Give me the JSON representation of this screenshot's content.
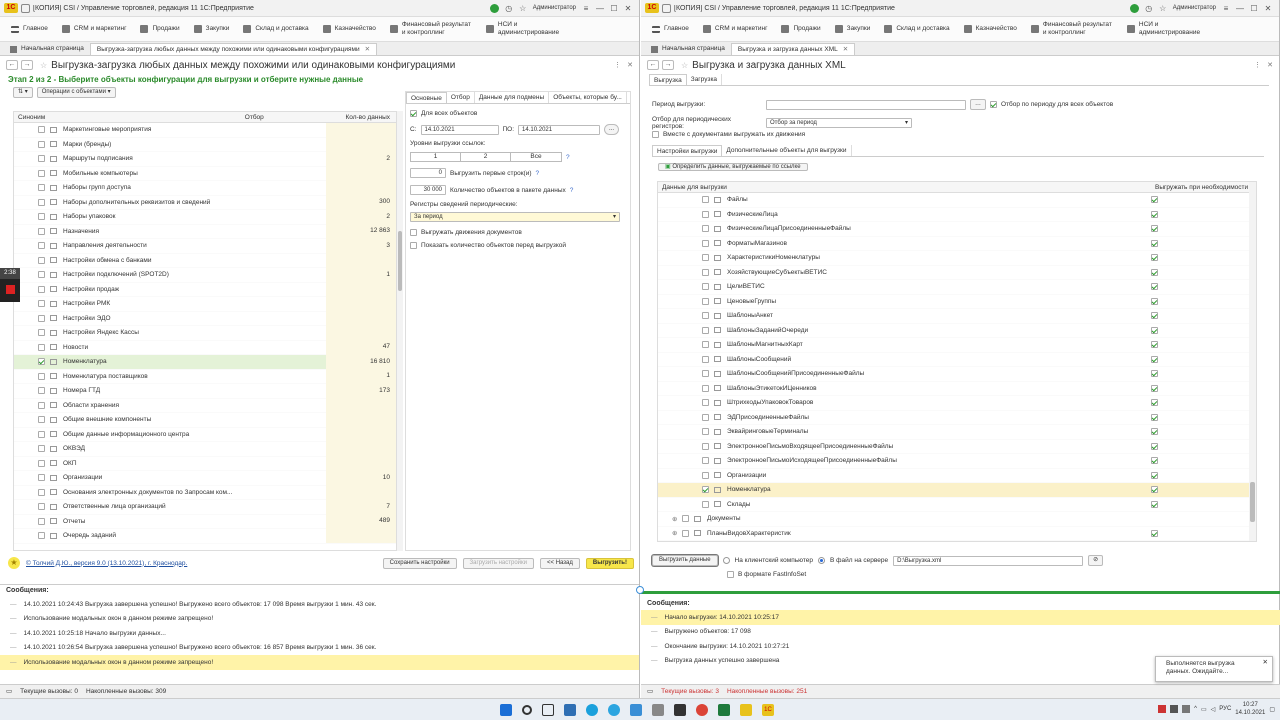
{
  "left_window": {
    "title": "[КОПИЯ] СSI / Управление торговлей, редакция 11 1С:Предприятие",
    "user": "Администратор",
    "sections": [
      "Главное",
      "CRM и маркетинг",
      "Продажи",
      "Закупки",
      "Склад и доставка",
      "Казначейство",
      "Финансовый результат и контроллинг",
      "НСИ и администрирование"
    ],
    "tab_home": "Начальная страница",
    "tab_active": "Выгрузка-загрузка любых данных между похожими или одинаковыми конфигурациями",
    "form_title": "Выгрузка-загрузка любых данных между похожими или одинаковыми конфигурациями",
    "step_label": "Этап 2 из 2 - Выберите объекты конфигурации для выгрузки и отберите нужные данные",
    "ops_button": "Операции с объектами",
    "columns": {
      "synonym": "Синоним",
      "filter": "Отбор",
      "count": "Кол-во данных"
    },
    "rows": [
      {
        "name": "Маркетинговые мероприятия",
        "count": "",
        "checked": false
      },
      {
        "name": "Марки (бренды)",
        "count": "",
        "checked": false
      },
      {
        "name": "Маршруты подписания",
        "count": "2",
        "checked": false
      },
      {
        "name": "Мобильные компьютеры",
        "count": "",
        "checked": false
      },
      {
        "name": "Наборы групп доступа",
        "count": "",
        "checked": false
      },
      {
        "name": "Наборы дополнительных реквизитов и сведений",
        "count": "300",
        "checked": false
      },
      {
        "name": "Наборы упаковок",
        "count": "2",
        "checked": false
      },
      {
        "name": "Назначения",
        "count": "12 863",
        "checked": false
      },
      {
        "name": "Направления деятельности",
        "count": "3",
        "checked": false
      },
      {
        "name": "Настройки обмена с банками",
        "count": "",
        "checked": false
      },
      {
        "name": "Настройки подключений (SPOT2D)",
        "count": "1",
        "checked": false
      },
      {
        "name": "Настройки продаж",
        "count": "",
        "checked": false
      },
      {
        "name": "Настройки РМК",
        "count": "",
        "checked": false
      },
      {
        "name": "Настройки ЭДО",
        "count": "",
        "checked": false
      },
      {
        "name": "Настройки Яндекс Кассы",
        "count": "",
        "checked": false
      },
      {
        "name": "Новости",
        "count": "47",
        "checked": false
      },
      {
        "name": "Номенклатура",
        "count": "16 810",
        "checked": true
      },
      {
        "name": "Номенклатура поставщиков",
        "count": "1",
        "checked": false
      },
      {
        "name": "Номера ГТД",
        "count": "173",
        "checked": false
      },
      {
        "name": "Области хранения",
        "count": "",
        "checked": false
      },
      {
        "name": "Общие внешние компоненты",
        "count": "",
        "checked": false
      },
      {
        "name": "Общие данные информационного центра",
        "count": "",
        "checked": false
      },
      {
        "name": "ОКВЭД",
        "count": "",
        "checked": false
      },
      {
        "name": "ОКП",
        "count": "",
        "checked": false
      },
      {
        "name": "Организации",
        "count": "10",
        "checked": false
      },
      {
        "name": "Основания электронных документов по Запросам ком...",
        "count": "",
        "checked": false
      },
      {
        "name": "Ответственные лица организаций",
        "count": "7",
        "checked": false
      },
      {
        "name": "Отчеты",
        "count": "489",
        "checked": false
      },
      {
        "name": "Очередь заданий",
        "count": "",
        "checked": false
      }
    ],
    "settings_tabs": [
      "Основные",
      "Отбор",
      "Данные для подмены",
      "Объекты, которые бу..."
    ],
    "for_all": "Для всех объектов",
    "from_label": "С:",
    "from_date": "14.10.2021",
    "to_label": "ПО:",
    "to_date": "14.10.2021",
    "date_btn": "...",
    "link_levels_label": "Уровни выгрузки ссылок:",
    "levels": [
      "1",
      "2",
      "Все"
    ],
    "first_rows_value": "0",
    "first_rows_label": "Выгрузить первые строк(и)",
    "packet_value": "30 000",
    "packet_label": "Количество объектов в пакете данных",
    "help": "?",
    "periodic_label": "Регистры сведений периодические:",
    "periodic_value": "За период",
    "cb_movements": "Выгружать движения документов",
    "cb_show_count": "Показать количество объектов перед выгрузкой",
    "info_link": "© Толчий Д.Ю., версия 9.0 (13.10.2021), г. Краснодар.",
    "save_settings": "Сохранить настройки",
    "load_settings": "Загрузить настройки",
    "back_button": "<< Назад",
    "export_button": "Выгрузить!",
    "messages_title": "Сообщения:",
    "messages": [
      "14.10.2021 10:24:43 Выгрузка завершена успешно! Выгружено всего объектов: 17 098 Время выгрузки 1 мин. 43 сек.",
      "Использование модальных окон в данном режиме запрещено!",
      "14.10.2021 10:25:18 Начало выгрузки данных...",
      "14.10.2021 10:26:54 Выгрузка завершена успешно! Выгружено всего объектов: 16 857 Время выгрузки 1 мин. 36 сек.",
      "Использование модальных окон в данном режиме запрещено!"
    ],
    "status_current": "Текущие вызовы: 0",
    "status_accum": "Накопленные вызовы: 309"
  },
  "right_window": {
    "title": "[КОПИЯ] СSI / Управление торговлей, редакция 11 1С:Предприятие",
    "user": "Администратор",
    "sections": [
      "Главное",
      "CRM и маркетинг",
      "Продажи",
      "Закупки",
      "Склад и доставка",
      "Казначейство",
      "Финансовый результат и контроллинг",
      "НСИ и администрирование"
    ],
    "tab_home": "Начальная страница",
    "tab_active": "Выгрузка и загрузка данных XML",
    "form_title": "Выгрузка и загрузка данных XML",
    "mode_tabs": [
      "Выгрузка",
      "Загрузка"
    ],
    "period_label": "Период выгрузки:",
    "period_value": "",
    "period_for_all": "Отбор по периоду для всех объектов",
    "periodic_filter_label": "Отбор для периодических регистров:",
    "periodic_filter_value": "Отбор за период",
    "with_docs": "Вместе с документами выгружать их движения",
    "sub_tabs": [
      "Настройки выгрузки",
      "Дополнительные объекты для выгрузки"
    ],
    "define_ref_button": "Определить данные, выгружаемые по ссылке",
    "col_data": "Данные для выгрузки",
    "col_if_needed": "Выгружать при необходимости",
    "tree_rows": [
      {
        "name": "Файлы",
        "checked": false,
        "need": true,
        "level": 2
      },
      {
        "name": "ФизическиеЛица",
        "checked": false,
        "need": true,
        "level": 2
      },
      {
        "name": "ФизическиеЛицаПрисоединенныеФайлы",
        "checked": false,
        "need": true,
        "level": 2
      },
      {
        "name": "ФорматыМагазинов",
        "checked": false,
        "need": true,
        "level": 2
      },
      {
        "name": "ХарактеристикиНоменклатуры",
        "checked": false,
        "need": true,
        "level": 2
      },
      {
        "name": "ХозяйствующиеСубъектыВЕТИС",
        "checked": false,
        "need": true,
        "level": 2
      },
      {
        "name": "ЦелиВЕТИС",
        "checked": false,
        "need": true,
        "level": 2
      },
      {
        "name": "ЦеновыеГруппы",
        "checked": false,
        "need": true,
        "level": 2
      },
      {
        "name": "ШаблоныАнкет",
        "checked": false,
        "need": true,
        "level": 2
      },
      {
        "name": "ШаблоныЗаданийОчереди",
        "checked": false,
        "need": true,
        "level": 2
      },
      {
        "name": "ШаблоныМагнитныхКарт",
        "checked": false,
        "need": true,
        "level": 2
      },
      {
        "name": "ШаблоныСообщений",
        "checked": false,
        "need": true,
        "level": 2
      },
      {
        "name": "ШаблоныСообщенийПрисоединенныеФайлы",
        "checked": false,
        "need": true,
        "level": 2
      },
      {
        "name": "ШаблоныЭтикетокИЦенников",
        "checked": false,
        "need": true,
        "level": 2
      },
      {
        "name": "ШтрихкодыУпаковокТоваров",
        "checked": false,
        "need": true,
        "level": 2
      },
      {
        "name": "ЭДПрисоединенныеФайлы",
        "checked": false,
        "need": true,
        "level": 2
      },
      {
        "name": "ЭквайринговыеТерминалы",
        "checked": false,
        "need": true,
        "level": 2
      },
      {
        "name": "ЭлектронноеПисьмоВходящееПрисоединенныеФайлы",
        "checked": false,
        "need": true,
        "level": 2
      },
      {
        "name": "ЭлектронноеПисьмоИсходящееПрисоединенныеФайлы",
        "checked": false,
        "need": true,
        "level": 2
      },
      {
        "name": "Организации",
        "checked": false,
        "need": true,
        "level": 2
      },
      {
        "name": "Номенклатура",
        "checked": true,
        "need": true,
        "level": 2,
        "selected": true
      },
      {
        "name": "Склады",
        "checked": false,
        "need": true,
        "level": 2
      },
      {
        "name": "Документы",
        "checked": false,
        "need": false,
        "level": 1
      },
      {
        "name": "ПланыВидовХарактеристик",
        "checked": false,
        "need": true,
        "level": 1
      }
    ],
    "export_data_button": "Выгрузить данные",
    "on_client": "На клиентский компьютер",
    "to_server": "В файл на сервере",
    "server_path": "D:\\Выгрузка.xml",
    "fastinfoset": "В формате FastInfoSet",
    "messages_title": "Сообщения:",
    "messages": [
      "Начало выгрузки: 14.10.2021 10:25:17",
      "Выгружено объектов: 17 098",
      "Окончание выгрузки: 14.10.2021 10:27:21",
      "Выгрузка данных успешно завершена"
    ],
    "status_current": "Текущие вызовы: 3",
    "status_accum": "Накопленные вызовы: 251"
  },
  "recorder": {
    "time": "2:38"
  },
  "toast": {
    "line1": "Выполняется выгрузка",
    "line2": "данных. Ожидайте..."
  },
  "taskbar": {
    "lang": "РУС",
    "time": "10:27",
    "date": "14.10.2021"
  },
  "colors": {
    "accent_green": "#2e9e3c",
    "highlight_yellow": "#fff3a8",
    "button_yellow": "#f7e64a",
    "selected_row": "#e4f2d7"
  }
}
